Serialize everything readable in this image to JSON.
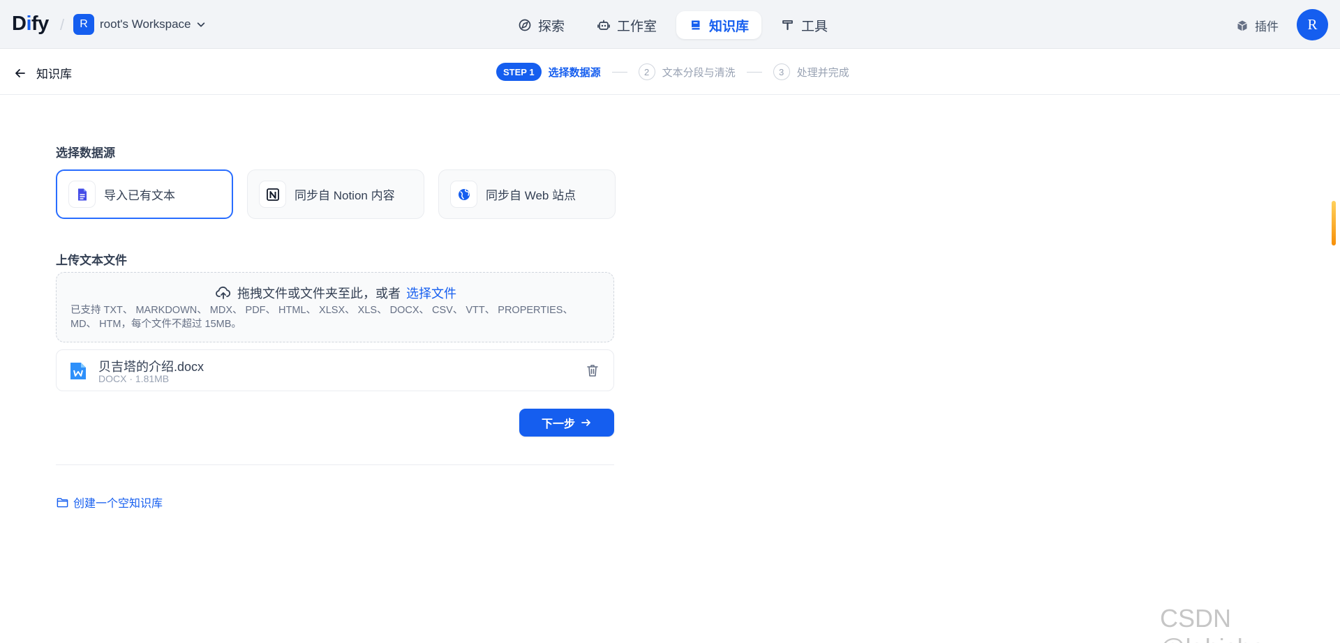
{
  "header": {
    "logo": {
      "part1": "D",
      "part2": "i",
      "part3": "fy"
    },
    "workspace": {
      "avatar": "R",
      "name": "root's Workspace"
    },
    "nav": [
      {
        "label": "探索",
        "icon": "compass-icon",
        "active": false
      },
      {
        "label": "工作室",
        "icon": "robot-icon",
        "active": false
      },
      {
        "label": "知识库",
        "icon": "book-icon",
        "active": true
      },
      {
        "label": "工具",
        "icon": "hammer-icon",
        "active": false
      }
    ],
    "plugins_label": "插件",
    "user_avatar": "R"
  },
  "subheader": {
    "back_label": "知识库",
    "steps": {
      "active_badge": "STEP 1",
      "active_label": "选择数据源",
      "step2_num": "2",
      "step2_label": "文本分段与清洗",
      "step3_num": "3",
      "step3_label": "处理并完成"
    }
  },
  "main": {
    "datasource_title": "选择数据源",
    "datasources": [
      {
        "label": "导入已有文本",
        "icon": "file-text-icon",
        "selected": true
      },
      {
        "label": "同步自 Notion 内容",
        "icon": "notion-icon",
        "selected": false
      },
      {
        "label": "同步自 Web 站点",
        "icon": "globe-icon",
        "selected": false
      }
    ],
    "upload_title": "上传文本文件",
    "dropzone": {
      "text": "拖拽文件或文件夹至此，或者",
      "link": "选择文件",
      "hint": "已支持 TXT、 MARKDOWN、 MDX、 PDF、 HTML、 XLSX、 XLS、 DOCX、 CSV、 VTT、 PROPERTIES、 MD、 HTM，每个文件不超过 15MB。"
    },
    "file": {
      "name": "贝吉塔的介绍.docx",
      "meta": "DOCX · 1.81MB"
    },
    "next_label": "下一步",
    "create_empty_label": "创建一个空知识库"
  },
  "watermark": "CSDN @lgbisha",
  "colors": {
    "primary": "#155eef",
    "topbar_bg": "#f2f4f7",
    "border": "#eaecf0"
  }
}
